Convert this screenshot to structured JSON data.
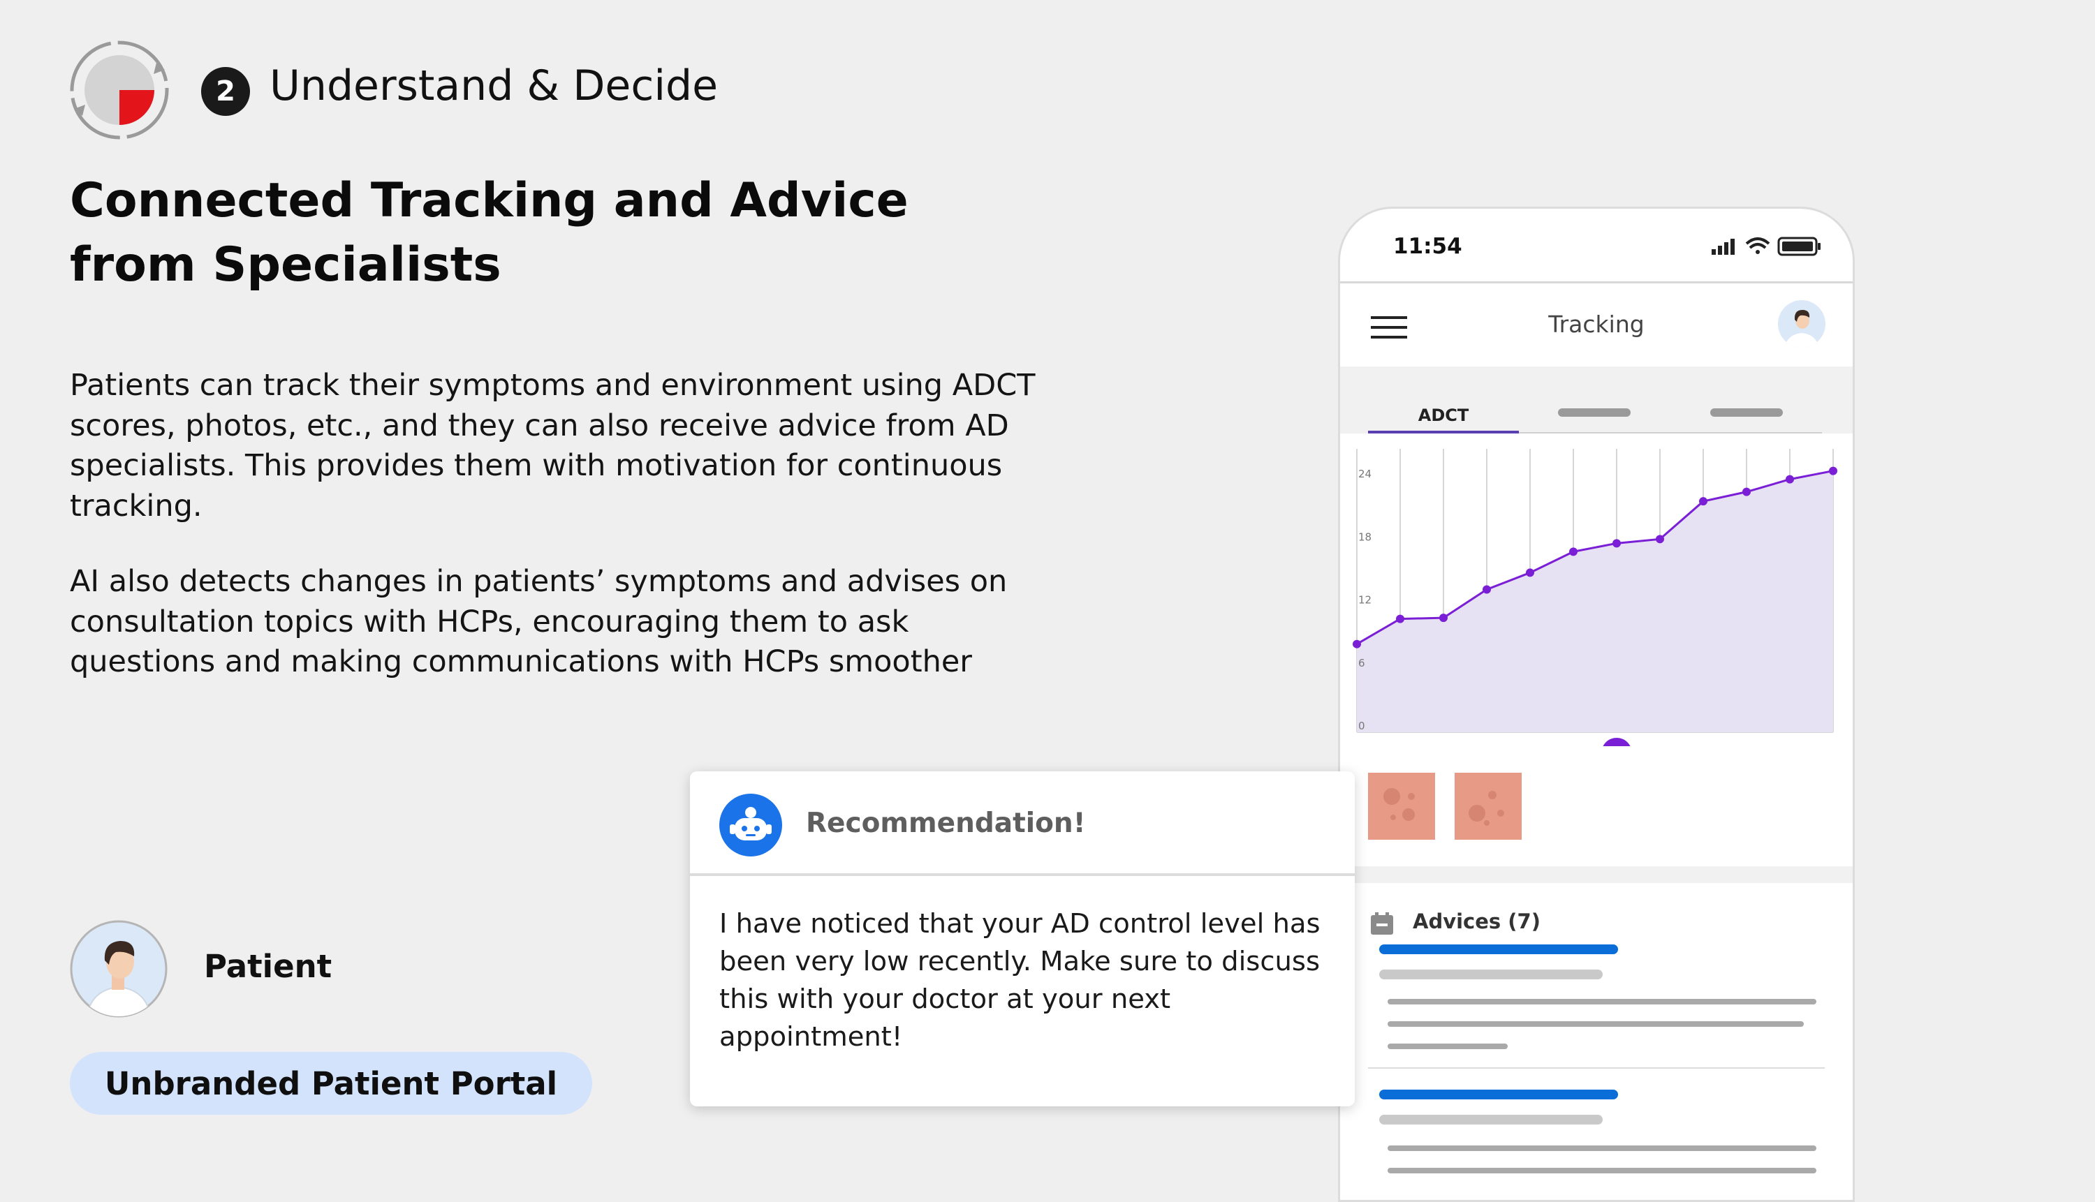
{
  "step": {
    "number": "2",
    "title": "Understand & Decide"
  },
  "heading": "Connected Tracking and Advice from Specialists",
  "paragraphs": [
    "Patients can track their symptoms and environment using ADCT scores, photos, etc., and they can also receive advice from AD specialists. This provides them with motivation for continuous tracking.",
    "AI also detects changes in patients’ symptoms and advises on consultation topics with HCPs, encouraging them to ask questions and making communications with HCPs smoother"
  ],
  "patient": {
    "label": "Patient",
    "portal": "Unbranded Patient Portal"
  },
  "phone": {
    "time": "11:54",
    "title": "Tracking",
    "tabs": [
      "ADCT",
      "",
      ""
    ],
    "active_tab": 0,
    "advices_label": "Advices (7)",
    "colors": {
      "accent": "#7a1fd6",
      "fill": "#e6e2f3",
      "link": "#0a6dd8",
      "thumb": "#e79b87"
    },
    "icons": [
      "signal-icon",
      "wifi-icon",
      "battery-icon",
      "menu-icon",
      "user-avatar",
      "calendar-icon"
    ]
  },
  "recommendation": {
    "title": "Recommendation!",
    "body": "I have noticed that your AD control level has been very low recently. Make sure to discuss this with your doctor at your next appointment!",
    "icon": "robot-icon"
  },
  "chart_data": {
    "type": "area",
    "x": [
      1,
      2,
      3,
      4,
      5,
      6,
      7,
      8,
      9,
      10,
      11,
      12
    ],
    "values": [
      8.4,
      10.8,
      10.9,
      13.6,
      15.2,
      17.2,
      18,
      18.4,
      22,
      22.9,
      24.1,
      24.9
    ],
    "yticks": [
      0,
      6,
      12,
      18,
      24
    ],
    "ylim": [
      0,
      27
    ],
    "highlight_x": 7,
    "grid": true
  }
}
